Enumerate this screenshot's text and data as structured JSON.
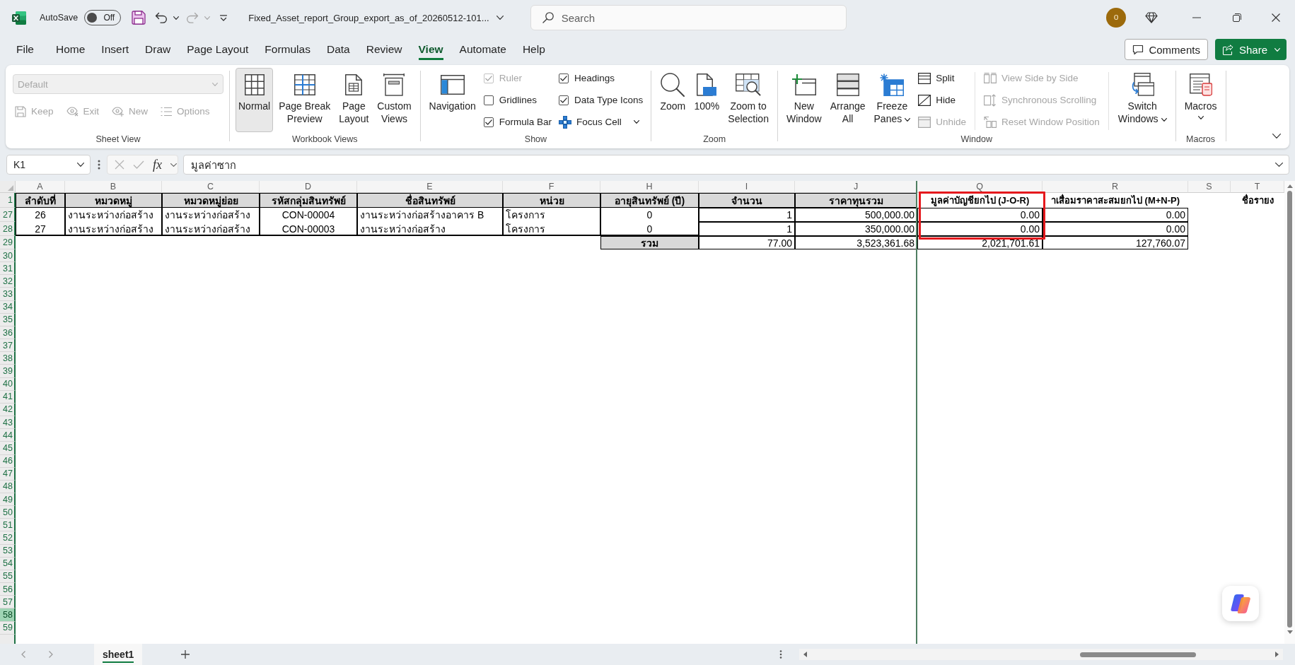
{
  "title_bar": {
    "autosave_label": "AutoSave",
    "autosave": {
      "on": false,
      "label": "Off"
    },
    "filename": "Fixed_Asset_report_Group_export_as_of_20260512-101...",
    "search": {
      "placeholder": "Search"
    },
    "avatar": "o"
  },
  "menu_tabs": [
    {
      "label": "File",
      "selected": false
    },
    {
      "label": "Home",
      "selected": false
    },
    {
      "label": "Insert",
      "selected": false
    },
    {
      "label": "Draw",
      "selected": false
    },
    {
      "label": "Page Layout",
      "selected": false
    },
    {
      "label": "Formulas",
      "selected": false
    },
    {
      "label": "Data",
      "selected": false
    },
    {
      "label": "Review",
      "selected": false
    },
    {
      "label": "View",
      "selected": true
    },
    {
      "label": "Automate",
      "selected": false
    },
    {
      "label": "Help",
      "selected": false
    }
  ],
  "actions": {
    "comments": "Comments",
    "share": "Share"
  },
  "ribbon": {
    "groups": [
      {
        "label": "Sheet View",
        "kind": "stacked",
        "items": [
          {
            "kind": "dropdown",
            "label": "Default",
            "disabled": true
          },
          {
            "kind": "small",
            "label": "Keep",
            "disabled": true,
            "menu": false
          },
          {
            "kind": "small",
            "label": "Exit",
            "disabled": true,
            "menu": false
          },
          {
            "kind": "small",
            "label": "New",
            "disabled": true,
            "menu": false
          },
          {
            "kind": "small",
            "label": "Options",
            "disabled": true,
            "menu": false
          }
        ]
      },
      {
        "label": "Workbook Views",
        "kind": "columns",
        "items": [
          {
            "kind": "large",
            "label": "Normal",
            "selected": true,
            "disabled": false,
            "menu": false
          },
          {
            "kind": "large",
            "label": "Page Break Preview",
            "selected": false,
            "disabled": false,
            "menu": false
          },
          {
            "kind": "large",
            "label": "Page Layout",
            "selected": false,
            "disabled": false,
            "menu": false
          },
          {
            "kind": "large",
            "label": "Custom Views",
            "selected": false,
            "disabled": false,
            "menu": false
          }
        ]
      },
      {
        "label": "Show",
        "kind": "columns",
        "items": [
          {
            "kind": "large",
            "label": "Navigation",
            "disabled": false,
            "menu": false
          },
          {
            "kind": "check",
            "label": "Ruler",
            "checked": true,
            "disabled": true
          },
          {
            "kind": "check",
            "label": "Gridlines",
            "checked": false,
            "disabled": false
          },
          {
            "kind": "check",
            "label": "Formula Bar",
            "checked": true,
            "disabled": false
          },
          {
            "kind": "check",
            "label": "Headings",
            "checked": true,
            "disabled": false
          },
          {
            "kind": "check",
            "label": "Data Type Icons",
            "checked": true,
            "disabled": false
          },
          {
            "kind": "small",
            "label": "Focus Cell",
            "disabled": false,
            "menu": true
          }
        ]
      },
      {
        "label": "Zoom",
        "kind": "columns",
        "items": [
          {
            "kind": "large",
            "label": "Zoom",
            "disabled": false,
            "menu": false
          },
          {
            "kind": "large",
            "label": "100%",
            "disabled": false,
            "menu": false
          },
          {
            "kind": "large",
            "label": "Zoom to Selection",
            "disabled": false,
            "menu": false
          }
        ]
      },
      {
        "label": "Window",
        "kind": "columns",
        "items": [
          {
            "kind": "large",
            "label": "New Window",
            "disabled": false,
            "menu": false
          },
          {
            "kind": "large",
            "label": "Arrange All",
            "disabled": false,
            "menu": false
          },
          {
            "kind": "large",
            "label": "Freeze Panes",
            "disabled": false,
            "menu": true
          },
          {
            "kind": "small",
            "label": "Split",
            "disabled": false,
            "menu": false
          },
          {
            "kind": "small",
            "label": "Hide",
            "disabled": false,
            "menu": false
          },
          {
            "kind": "small",
            "label": "Unhide",
            "disabled": true,
            "menu": false
          },
          {
            "kind": "separator"
          },
          {
            "kind": "small",
            "label": "View Side by Side",
            "disabled": true,
            "menu": false
          },
          {
            "kind": "small",
            "label": "Synchronous Scrolling",
            "disabled": true,
            "menu": false
          },
          {
            "kind": "small",
            "label": "Reset Window Position",
            "disabled": true,
            "menu": false
          },
          {
            "kind": "separator"
          },
          {
            "kind": "large",
            "label": "Switch Windows",
            "disabled": false,
            "menu": true
          }
        ]
      },
      {
        "label": "Macros",
        "kind": "columns",
        "items": [
          {
            "kind": "large",
            "label": "Macros",
            "disabled": false,
            "menu": true
          }
        ]
      }
    ]
  },
  "formula_bar": {
    "name_box": "K1",
    "function_label": "fx",
    "formula": "มูลค่าซาก"
  },
  "sheet": {
    "columns": [
      {
        "letter": "A",
        "freeze_line_after": false,
        "highlighted": false
      },
      {
        "letter": "B",
        "freeze_line_after": false,
        "highlighted": false
      },
      {
        "letter": "C",
        "freeze_line_after": false,
        "highlighted": false
      },
      {
        "letter": "D",
        "freeze_line_after": false,
        "highlighted": false
      },
      {
        "letter": "E",
        "freeze_line_after": false,
        "highlighted": false
      },
      {
        "letter": "F",
        "freeze_line_after": false,
        "highlighted": false
      },
      {
        "letter": "H",
        "freeze_line_after": false,
        "highlighted": false
      },
      {
        "letter": "I",
        "freeze_line_after": false,
        "highlighted": false
      },
      {
        "letter": "J",
        "freeze_line_after": true,
        "highlighted": false
      },
      {
        "letter": "Q",
        "freeze_line_after": false,
        "highlighted": true
      },
      {
        "letter": "R",
        "freeze_line_after": false,
        "highlighted": false
      },
      {
        "letter": "S",
        "freeze_line_after": false,
        "highlighted": false
      },
      {
        "letter": "T",
        "freeze_line_after": false,
        "highlighted": false
      }
    ],
    "rows": [
      {
        "number": "1",
        "kind": "header",
        "highlighted": false,
        "cells": [
          {
            "text": "ลำดับที่",
            "kind": "head"
          },
          {
            "text": "หมวดหมู่",
            "kind": "head"
          },
          {
            "text": "หมวดหมู่ย่อย",
            "kind": "head"
          },
          {
            "text": "รหัสกลุ่มสินทรัพย์",
            "kind": "head"
          },
          {
            "text": "ชื่อสินทรัพย์",
            "kind": "head"
          },
          {
            "text": "หน่วย",
            "kind": "head"
          },
          {
            "text": "อายุสินทรัพย์ (ปี)",
            "kind": "head"
          },
          {
            "text": "จำนวน",
            "kind": "head"
          },
          {
            "text": "ราคาทุนรวม",
            "kind": "head"
          },
          {
            "text": "มูลค่าบัญชียกไป (J-O-R)",
            "kind": "title"
          },
          {
            "text": "าเสื่อมราคาสะสมยกไป (M+N-P)",
            "kind": "title"
          },
          null,
          {
            "text": "ชื่อรายง",
            "kind": "title"
          }
        ]
      },
      {
        "number": "27",
        "kind": "data",
        "highlighted": false,
        "cells": [
          {
            "text": "26",
            "kind": "center"
          },
          {
            "text": "งานระหว่างก่อสร้าง",
            "kind": "text"
          },
          {
            "text": "งานระหว่างก่อสร้าง",
            "kind": "text"
          },
          {
            "text": "CON-00004",
            "kind": "center"
          },
          {
            "text": "งานระหว่างก่อสร้างอาคาร B",
            "kind": "text"
          },
          {
            "text": "โครงการ",
            "kind": "text"
          },
          {
            "text": "0",
            "kind": "center"
          },
          {
            "text": "1",
            "kind": "number"
          },
          {
            "text": "500,000.00",
            "kind": "number"
          },
          {
            "text": "0.00",
            "kind": "number"
          },
          {
            "text": "0.00",
            "kind": "number"
          }
        ]
      },
      {
        "number": "28",
        "kind": "data",
        "highlighted": false,
        "cells": [
          {
            "text": "27",
            "kind": "center"
          },
          {
            "text": "งานระหว่างก่อสร้าง",
            "kind": "text"
          },
          {
            "text": "งานระหว่างก่อสร้าง",
            "kind": "text"
          },
          {
            "text": "CON-00003",
            "kind": "center"
          },
          {
            "text": "งานระหว่างก่อสร้าง",
            "kind": "text"
          },
          {
            "text": "โครงการ",
            "kind": "text"
          },
          {
            "text": "0",
            "kind": "center"
          },
          {
            "text": "1",
            "kind": "number"
          },
          {
            "text": "350,000.00",
            "kind": "number"
          },
          {
            "text": "0.00",
            "kind": "number"
          },
          {
            "text": "0.00",
            "kind": "number"
          }
        ]
      },
      {
        "number": "29",
        "kind": "total",
        "highlighted": false,
        "cells": [
          null,
          null,
          null,
          null,
          null,
          null,
          {
            "text": "รวม",
            "kind": "total"
          },
          {
            "text": "77.00",
            "kind": "number"
          },
          {
            "text": "3,523,361.68",
            "kind": "number"
          },
          {
            "text": "2,021,701.61",
            "kind": "number"
          },
          {
            "text": "127,760.07",
            "kind": "number"
          }
        ]
      },
      {
        "number": "30",
        "kind": "empty",
        "highlighted": false
      },
      {
        "number": "31",
        "kind": "empty",
        "highlighted": false
      },
      {
        "number": "32",
        "kind": "empty",
        "highlighted": false
      },
      {
        "number": "33",
        "kind": "empty",
        "highlighted": false
      },
      {
        "number": "34",
        "kind": "empty",
        "highlighted": false
      },
      {
        "number": "35",
        "kind": "empty",
        "highlighted": false
      },
      {
        "number": "36",
        "kind": "empty",
        "highlighted": false
      },
      {
        "number": "37",
        "kind": "empty",
        "highlighted": false
      },
      {
        "number": "38",
        "kind": "empty",
        "highlighted": false
      },
      {
        "number": "39",
        "kind": "empty",
        "highlighted": false
      },
      {
        "number": "40",
        "kind": "empty",
        "highlighted": false
      },
      {
        "number": "41",
        "kind": "empty",
        "highlighted": false
      },
      {
        "number": "42",
        "kind": "empty",
        "highlighted": false
      },
      {
        "number": "43",
        "kind": "empty",
        "highlighted": false
      },
      {
        "number": "44",
        "kind": "empty",
        "highlighted": false
      },
      {
        "number": "45",
        "kind": "empty",
        "highlighted": false
      },
      {
        "number": "46",
        "kind": "empty",
        "highlighted": false
      },
      {
        "number": "47",
        "kind": "empty",
        "highlighted": false
      },
      {
        "number": "48",
        "kind": "empty",
        "highlighted": false
      },
      {
        "number": "49",
        "kind": "empty",
        "highlighted": false
      },
      {
        "number": "50",
        "kind": "empty",
        "highlighted": false
      },
      {
        "number": "51",
        "kind": "empty",
        "highlighted": false
      },
      {
        "number": "52",
        "kind": "empty",
        "highlighted": false
      },
      {
        "number": "53",
        "kind": "empty",
        "highlighted": false
      },
      {
        "number": "54",
        "kind": "empty",
        "highlighted": false
      },
      {
        "number": "55",
        "kind": "empty",
        "highlighted": false
      },
      {
        "number": "56",
        "kind": "empty",
        "highlighted": false
      },
      {
        "number": "57",
        "kind": "empty",
        "highlighted": false
      },
      {
        "number": "58",
        "kind": "empty",
        "highlighted": true
      },
      {
        "number": "59",
        "kind": "empty",
        "highlighted": false
      }
    ]
  },
  "sheet_tabs": [
    {
      "label": "sheet1",
      "selected": true
    }
  ]
}
